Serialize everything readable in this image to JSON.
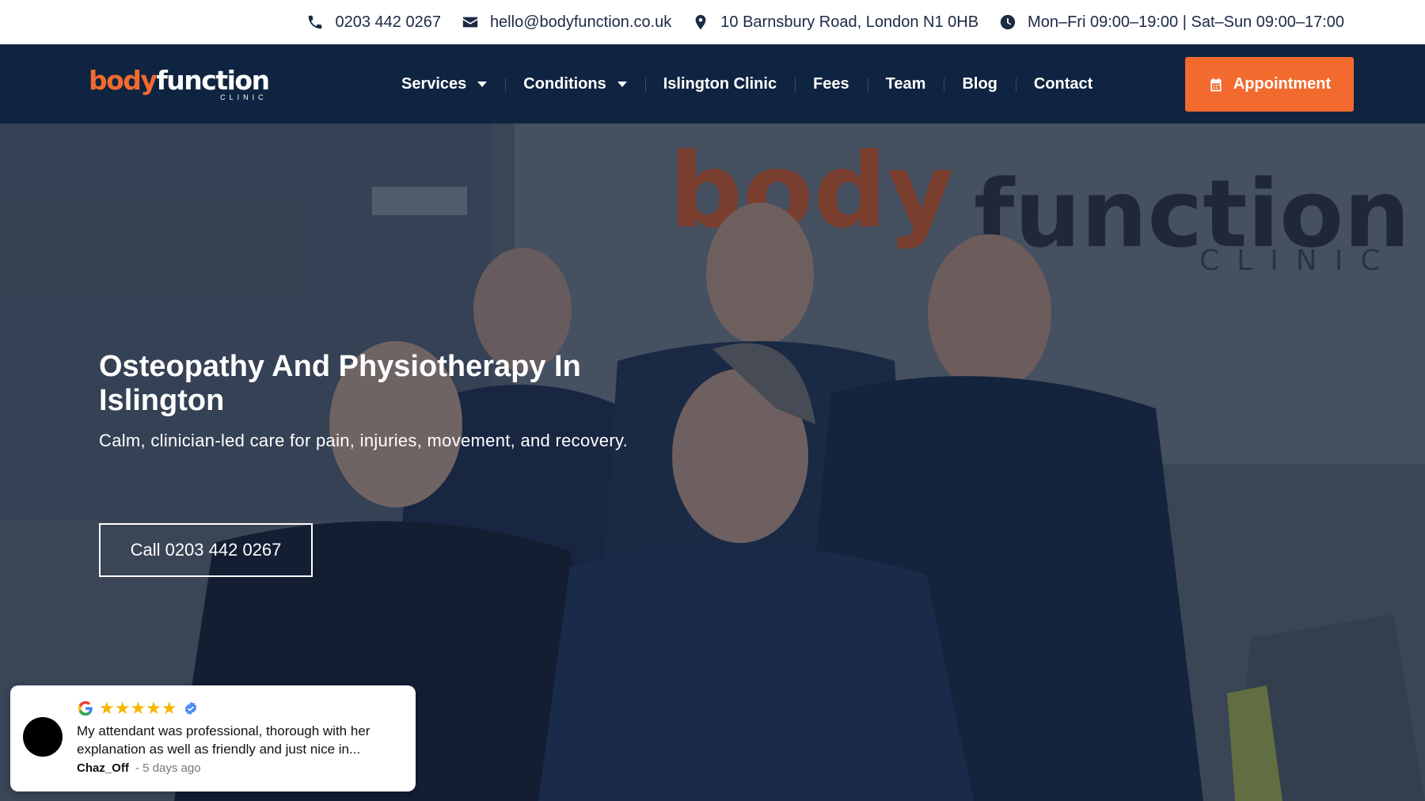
{
  "topbar": {
    "phone": "0203 442 0267",
    "email": "hello@bodyfunction.co.uk",
    "address": "10 Barnsbury Road, London N1 0HB",
    "hours": "Mon–Fri 09:00–19:00 | Sat–Sun 09:00–17:00",
    "icons": [
      "phone-icon",
      "envelope-icon",
      "map-pin-icon",
      "clock-icon"
    ]
  },
  "logo": {
    "part1": "body",
    "part2": "function",
    "tagline": "CLINIC"
  },
  "nav": {
    "items": [
      {
        "label": "Services",
        "has_dropdown": true
      },
      {
        "label": "Conditions",
        "has_dropdown": true
      },
      {
        "label": "Islington Clinic",
        "has_dropdown": false
      },
      {
        "label": "Fees",
        "has_dropdown": false
      },
      {
        "label": "Team",
        "has_dropdown": false
      },
      {
        "label": "Blog",
        "has_dropdown": false
      },
      {
        "label": "Contact",
        "has_dropdown": false
      }
    ],
    "appointment_label": "Appointment"
  },
  "hero": {
    "title": "Osteopathy And Physiotherapy In Islington",
    "subtitle": "Calm, clinician-led care for pain, injuries, movement, and recovery.",
    "cta_label": "Call 0203 442 0267",
    "wall_sign": {
      "part1": "body",
      "part2": "function",
      "tagline": "CLINIC"
    }
  },
  "review": {
    "text": "My attendant was professional, thorough with her explanation as well as friendly and just nice in...",
    "author": "Chaz_Off",
    "time": "- 5 days ago",
    "rating": 5,
    "stars": "★★★★★"
  },
  "colors": {
    "brand_orange": "#f26a2e",
    "navy": "#0f2440",
    "topbar_text": "#1b2a45",
    "star": "#f7b500"
  }
}
